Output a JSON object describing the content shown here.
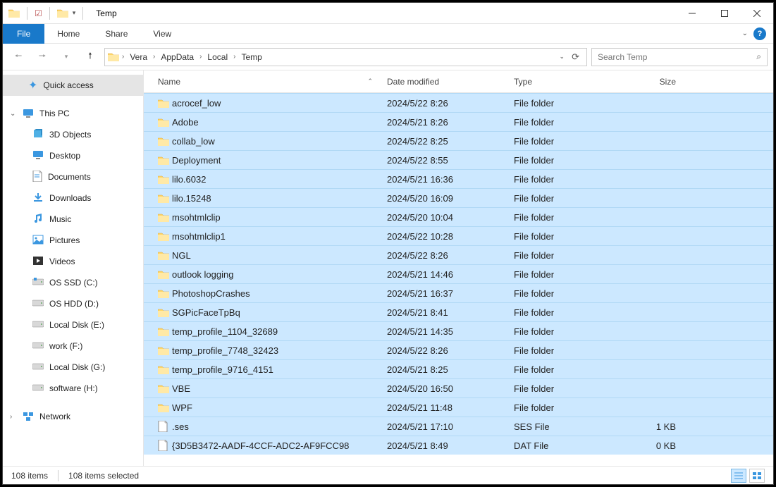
{
  "window": {
    "title": "Temp"
  },
  "ribbon": {
    "file": "File",
    "home": "Home",
    "share": "Share",
    "view": "View"
  },
  "breadcrumbs": [
    "Vera",
    "AppData",
    "Local",
    "Temp"
  ],
  "search": {
    "placeholder": "Search Temp"
  },
  "tree": {
    "quick_access": "Quick access",
    "this_pc": "This PC",
    "items": [
      {
        "label": "3D Objects",
        "icon": "3d"
      },
      {
        "label": "Desktop",
        "icon": "desktop"
      },
      {
        "label": "Documents",
        "icon": "docs"
      },
      {
        "label": "Downloads",
        "icon": "downloads"
      },
      {
        "label": "Music",
        "icon": "music"
      },
      {
        "label": "Pictures",
        "icon": "pictures"
      },
      {
        "label": "Videos",
        "icon": "videos"
      },
      {
        "label": "OS SSD (C:)",
        "icon": "drive-os"
      },
      {
        "label": "OS HDD (D:)",
        "icon": "drive"
      },
      {
        "label": "Local Disk (E:)",
        "icon": "drive"
      },
      {
        "label": "work (F:)",
        "icon": "drive"
      },
      {
        "label": "Local Disk (G:)",
        "icon": "drive"
      },
      {
        "label": "software (H:)",
        "icon": "drive"
      }
    ],
    "network": "Network"
  },
  "columns": {
    "name": "Name",
    "date": "Date modified",
    "type": "Type",
    "size": "Size"
  },
  "rows": [
    {
      "name": "acrocef_low",
      "date": "2024/5/22 8:26",
      "type": "File folder",
      "size": "",
      "icon": "folder"
    },
    {
      "name": "Adobe",
      "date": "2024/5/21 8:26",
      "type": "File folder",
      "size": "",
      "icon": "folder"
    },
    {
      "name": "collab_low",
      "date": "2024/5/22 8:25",
      "type": "File folder",
      "size": "",
      "icon": "folder"
    },
    {
      "name": "Deployment",
      "date": "2024/5/22 8:55",
      "type": "File folder",
      "size": "",
      "icon": "folder"
    },
    {
      "name": "lilo.6032",
      "date": "2024/5/21 16:36",
      "type": "File folder",
      "size": "",
      "icon": "folder"
    },
    {
      "name": "lilo.15248",
      "date": "2024/5/20 16:09",
      "type": "File folder",
      "size": "",
      "icon": "folder"
    },
    {
      "name": "msohtmlclip",
      "date": "2024/5/20 10:04",
      "type": "File folder",
      "size": "",
      "icon": "folder"
    },
    {
      "name": "msohtmlclip1",
      "date": "2024/5/22 10:28",
      "type": "File folder",
      "size": "",
      "icon": "folder"
    },
    {
      "name": "NGL",
      "date": "2024/5/22 8:26",
      "type": "File folder",
      "size": "",
      "icon": "folder"
    },
    {
      "name": "outlook logging",
      "date": "2024/5/21 14:46",
      "type": "File folder",
      "size": "",
      "icon": "folder"
    },
    {
      "name": "PhotoshopCrashes",
      "date": "2024/5/21 16:37",
      "type": "File folder",
      "size": "",
      "icon": "folder"
    },
    {
      "name": "SGPicFaceTpBq",
      "date": "2024/5/21 8:41",
      "type": "File folder",
      "size": "",
      "icon": "folder"
    },
    {
      "name": "temp_profile_1104_32689",
      "date": "2024/5/21 14:35",
      "type": "File folder",
      "size": "",
      "icon": "folder"
    },
    {
      "name": "temp_profile_7748_32423",
      "date": "2024/5/22 8:26",
      "type": "File folder",
      "size": "",
      "icon": "folder"
    },
    {
      "name": "temp_profile_9716_4151",
      "date": "2024/5/21 8:25",
      "type": "File folder",
      "size": "",
      "icon": "folder"
    },
    {
      "name": "VBE",
      "date": "2024/5/20 16:50",
      "type": "File folder",
      "size": "",
      "icon": "folder"
    },
    {
      "name": "WPF",
      "date": "2024/5/21 11:48",
      "type": "File folder",
      "size": "",
      "icon": "folder"
    },
    {
      "name": ".ses",
      "date": "2024/5/21 17:10",
      "type": "SES File",
      "size": "1 KB",
      "icon": "file"
    },
    {
      "name": "{3D5B3472-AADF-4CCF-ADC2-AF9FCC98",
      "date": "2024/5/21 8:49",
      "type": "DAT File",
      "size": "0 KB",
      "icon": "file"
    }
  ],
  "status": {
    "count": "108 items",
    "selected": "108 items selected"
  }
}
